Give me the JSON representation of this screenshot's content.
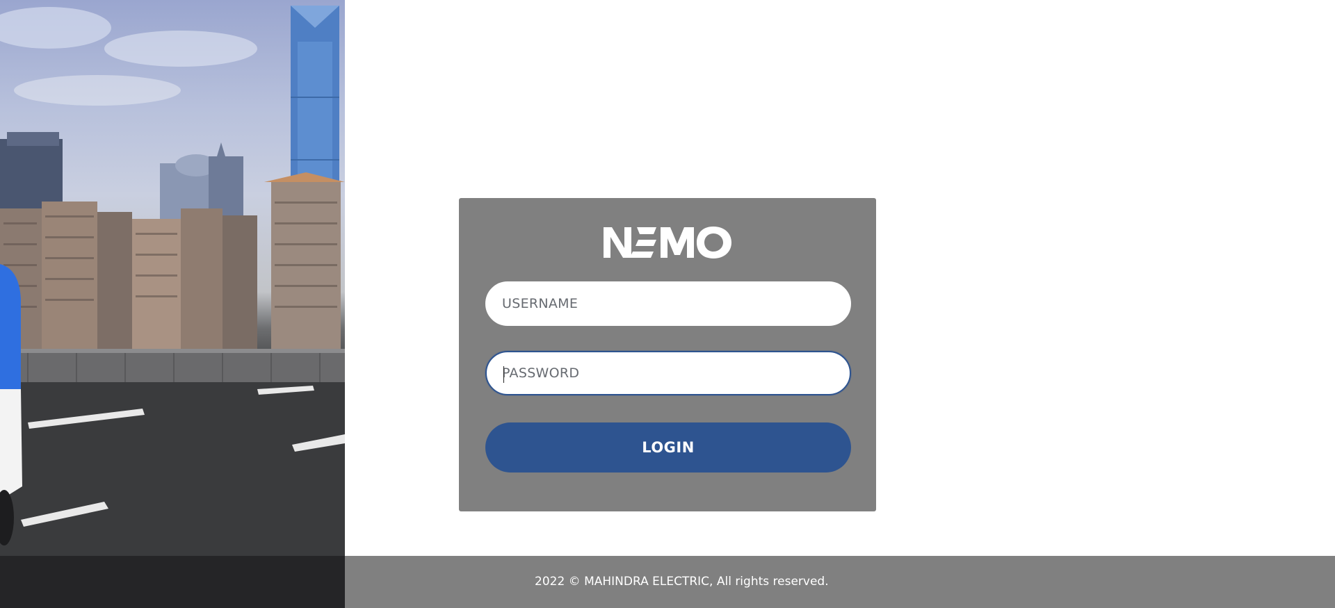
{
  "brand": {
    "logo_text": "NEMO"
  },
  "login_form": {
    "username_placeholder": "USERNAME",
    "password_placeholder": "PASSWORD",
    "login_label": "LOGIN"
  },
  "footer": {
    "copyright": "2022 © MAHINDRA ELECTRIC, All rights reserved."
  },
  "colors": {
    "card_background": "#808080",
    "primary_button": "#2e5490",
    "footer_background": "#808080",
    "focus_border": "#2e5490"
  },
  "icons": {
    "hero": "city-skyline-road-image",
    "logo": "nemo-logo"
  }
}
